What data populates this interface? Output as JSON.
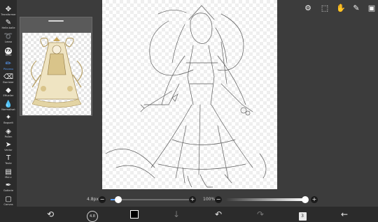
{
  "toolbar": {
    "tools": [
      {
        "icon": "✥",
        "label": "Transformer",
        "active": false
      },
      {
        "icon": "✎",
        "label": "Helle-balle",
        "active": false
      },
      {
        "icon": "➰",
        "label": "Lasso",
        "active": false
      },
      {
        "icon": "FX",
        "label": "Filtre",
        "active": false
      },
      {
        "icon": "✏",
        "label": "Pinceau",
        "active": true
      },
      {
        "icon": "⌫",
        "label": "Barrister",
        "active": false
      },
      {
        "icon": "◆",
        "label": "Effueiler",
        "active": false
      },
      {
        "icon": "💧",
        "label": "Normalisat",
        "active": false
      },
      {
        "icon": "✦",
        "label": "Baguelt",
        "active": false
      },
      {
        "icon": "◈",
        "label": "Pollen",
        "active": false
      },
      {
        "icon": "➤",
        "label": "Vector",
        "active": false
      },
      {
        "icon": "T",
        "label": "Texte",
        "active": false
      },
      {
        "icon": "▤",
        "label": "Mar.c",
        "active": false
      },
      {
        "icon": "✒",
        "label": "Gotlerie",
        "active": false
      },
      {
        "icon": "▢",
        "label": "Canvas",
        "active": false
      }
    ]
  },
  "top_icons": [
    "toggle-icon",
    "select-icon",
    "hand-icon",
    "pen-icon",
    "image-icon"
  ],
  "sliders": {
    "size_label": "4.8px",
    "size_fraction": 0.1,
    "opacity_label": "100%",
    "opacity_fraction": 1.0
  },
  "bottombar": {
    "layer_count": "3",
    "brush_size_label": "4.8"
  },
  "colors": {
    "accent": "#5aa0ff",
    "ui_dark": "#2b2b2b",
    "ui_mid": "#3c3c3c"
  }
}
